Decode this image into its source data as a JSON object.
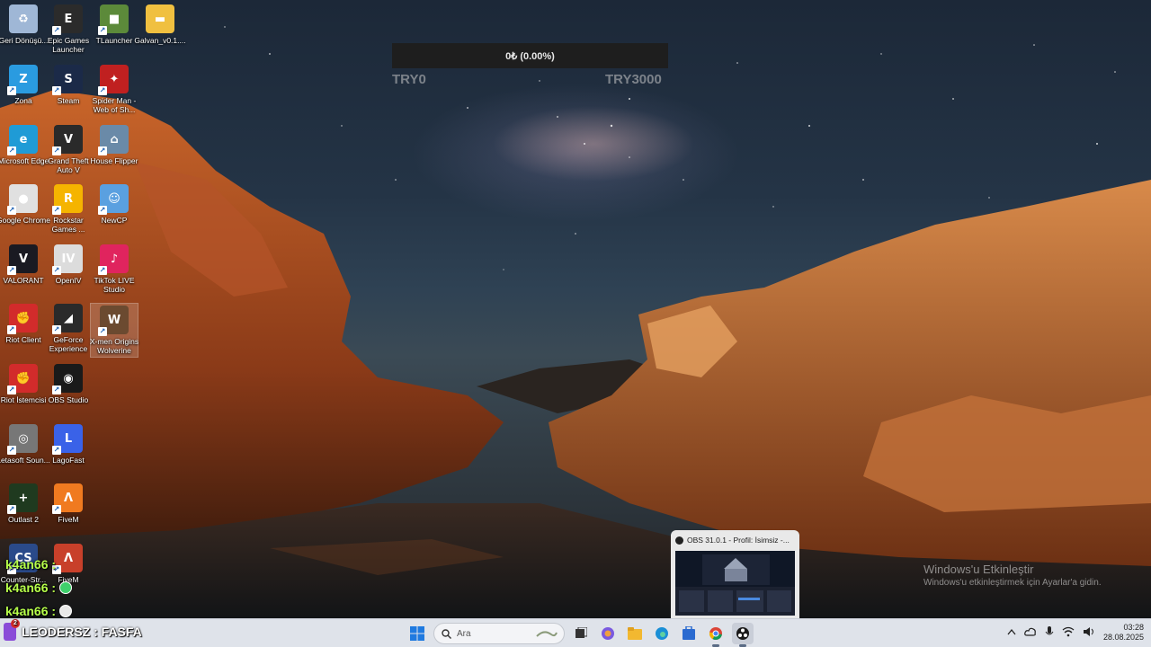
{
  "desktop": {
    "icons": [
      {
        "label": "Geri Dönüşü...",
        "icon": "recycle-bin-icon",
        "color": "#9fb7d6"
      },
      {
        "label": "Epic Games Launcher",
        "icon": "epic-games-icon",
        "color": "#2b2b2b"
      },
      {
        "label": "TLauncher",
        "icon": "minecraft-grass-icon",
        "color": "#5c8a3a"
      },
      {
        "label": "Galvan_v0.1....",
        "icon": "folder-icon",
        "color": "#f0c040"
      },
      {
        "label": "Zona",
        "icon": "zona-icon",
        "color": "#2a9be0"
      },
      {
        "label": "Steam",
        "icon": "steam-icon",
        "color": "#1b2a48"
      },
      {
        "label": "Spider Man - Web of Sh...",
        "icon": "spiderman-icon",
        "color": "#c02020"
      },
      {
        "label": "Microsoft Edge",
        "icon": "edge-icon",
        "color": "#1f9bd6"
      },
      {
        "label": "Grand Theft Auto V",
        "icon": "gta-icon",
        "color": "#2a2a2a"
      },
      {
        "label": "House Flipper",
        "icon": "house-flipper-icon",
        "color": "#6a8aa8"
      },
      {
        "label": "Google Chrome",
        "icon": "chrome-icon",
        "color": "#e0e0e0"
      },
      {
        "label": "Rockstar Games ...",
        "icon": "rockstar-icon",
        "color": "#f5b400"
      },
      {
        "label": "NewCP",
        "icon": "newcp-icon",
        "color": "#5aa0e0"
      },
      {
        "label": "VALORANT",
        "icon": "valorant-icon",
        "color": "#1a1a22"
      },
      {
        "label": "OpenIV",
        "icon": "openiv-icon",
        "color": "#dcdcdc"
      },
      {
        "label": "TikTok LIVE Studio",
        "icon": "tiktok-icon",
        "color": "#e0245e"
      },
      {
        "label": "Riot Client",
        "icon": "riot-icon",
        "color": "#d22b2b"
      },
      {
        "label": "GeForce Experience",
        "icon": "geforce-icon",
        "color": "#2a2a2a"
      },
      {
        "label": "X-men Origins Wolverine",
        "icon": "wolverine-icon",
        "color": "#6b4a30"
      },
      {
        "label": "Riot İstemcisi",
        "icon": "riot-icon",
        "color": "#d22b2b"
      },
      {
        "label": "OBS Studio",
        "icon": "obs-icon",
        "color": "#1a1a1a"
      },
      {
        "label": "Letasoft Soun...",
        "icon": "speaker-icon",
        "color": "#777777"
      },
      {
        "label": "LagoFast",
        "icon": "lagofast-icon",
        "color": "#3a62e8"
      },
      {
        "label": "Outlast 2",
        "icon": "outlast-icon",
        "color": "#1f3a1f"
      },
      {
        "label": "FiveM",
        "icon": "fivem-icon",
        "color": "#f07a20"
      },
      {
        "label": "Counter-Str...",
        "icon": "counter-strike-icon",
        "color": "#2a4a8a"
      },
      {
        "label": "FiveM",
        "icon": "fivem-icon",
        "color": "#c8402a"
      }
    ]
  },
  "progress": {
    "text": "0₺ (0.00%)",
    "value": 0,
    "min_label": "TRY0",
    "max_label": "TRY3000"
  },
  "chat": [
    {
      "user": "k4an66 :",
      "badge": "none"
    },
    {
      "user": "k4an66 :",
      "badge": "green"
    },
    {
      "user": "k4an66 :",
      "badge": "avatar"
    }
  ],
  "watermark": {
    "title": "Windows'u Etkinleştir",
    "subtitle": "Windows'u etkinleştirmek için Ayarlar'a gidin."
  },
  "thumbnail": {
    "title": "OBS 31.0.1 - Profil: İsimsiz -..."
  },
  "taskbar": {
    "left_text": "LEODERSZ : FASFA",
    "notification_count": "2",
    "search_placeholder": "Ara",
    "clock_time": "03:28",
    "clock_date": "28.08.2025"
  },
  "colors": {
    "chat": "#b6ff4a",
    "taskbar": "#dfe3ea",
    "progress_bg": "#1e1e1e"
  }
}
